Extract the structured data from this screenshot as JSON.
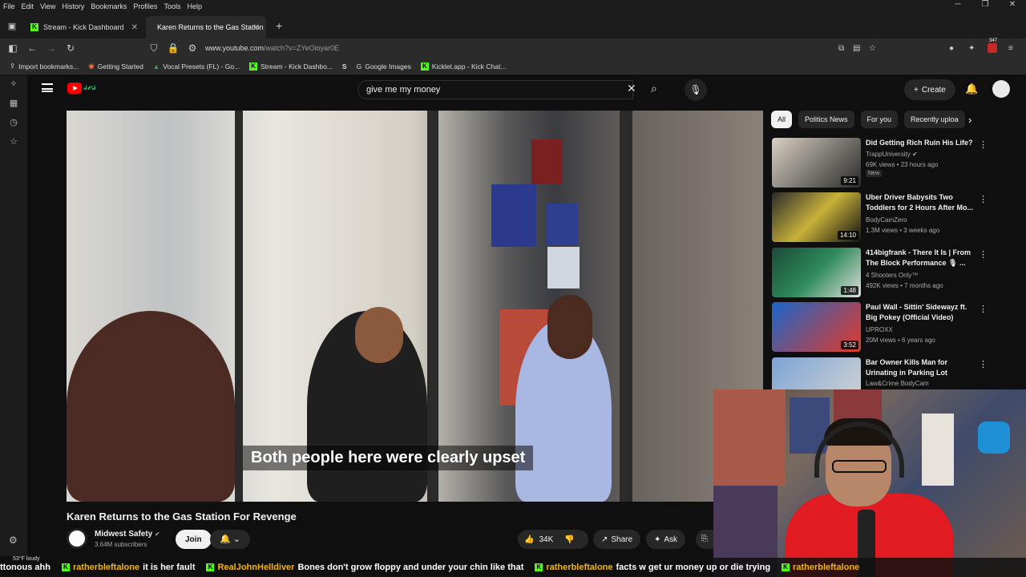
{
  "menubar": [
    "File",
    "Edit",
    "View",
    "History",
    "Bookmarks",
    "Profiles",
    "Tools",
    "Help"
  ],
  "tabs": [
    {
      "label": "Stream - Kick Dashboard",
      "active": false
    },
    {
      "label": "Karen Returns to the Gas Station",
      "active": true
    }
  ],
  "address": {
    "url_host": "www.youtube.com",
    "url_path": "/watch?v=ZYeOioyar0E"
  },
  "bookmarks": [
    "Import bookmarks...",
    "Getting Started",
    "Vocal Presets (FL) - Go...",
    "Stream - Kick Dashbo...",
    "Google Images",
    "Kicklet.app - Kick Chat..."
  ],
  "extension_badge": "347",
  "search": {
    "query": "give me my money"
  },
  "header": {
    "create_label": "Create"
  },
  "video": {
    "subtitle": "Both people here were clearly upset",
    "title": "Karen Returns to the Gas Station For Revenge",
    "channel": "Midwest Safety",
    "subscribers": "3.64M subscribers",
    "join_label": "Join",
    "likes": "34K",
    "share_label": "Share",
    "ask_label": "Ask"
  },
  "chips": [
    "All",
    "Politics News",
    "For you",
    "Recently uploa"
  ],
  "recommendations": [
    {
      "title": "Did Getting Rich Ruin His Life?",
      "channel": "TrappUniversity",
      "meta": "69K views • 23 hours ago",
      "duration": "9:21",
      "badge": "New"
    },
    {
      "title": "Uber Driver Babysits Two Toddlers for 2 Hours After Mo...",
      "channel": "BodyCamZero",
      "meta": "1.3M views • 3 weeks ago",
      "duration": "14:10",
      "badge": ""
    },
    {
      "title": "414bigfrank - There It Is | From The Block Performance 🎙 ...",
      "channel": "4 Shooters Only™",
      "meta": "492K views • 7 months ago",
      "duration": "1:48",
      "badge": ""
    },
    {
      "title": "Paul Wall - Sittin' Sidewayz ft. Big Pokey (Official Video)",
      "channel": "UPROXX",
      "meta": "20M views • 6 years ago",
      "duration": "3:52",
      "badge": ""
    },
    {
      "title": "Bar Owner Kills Man for Urinating in Parking Lot",
      "channel": "Law&Crime BodyCam",
      "meta": "",
      "duration": "",
      "badge": ""
    }
  ],
  "weather": {
    "temp": "53°F",
    "cond": "loudy"
  },
  "ticker": [
    {
      "user": "",
      "msg": "ttonous ahh"
    },
    {
      "user": "ratherbleftalone",
      "msg": "it is her fault"
    },
    {
      "user": "RealJohnHelldiver",
      "msg": "Bones don't grow floppy and under your chin like that"
    },
    {
      "user": "ratherbleftalone",
      "msg": "facts w get ur money up or die trying"
    },
    {
      "user": "ratherbleftalone",
      "msg": ""
    }
  ]
}
